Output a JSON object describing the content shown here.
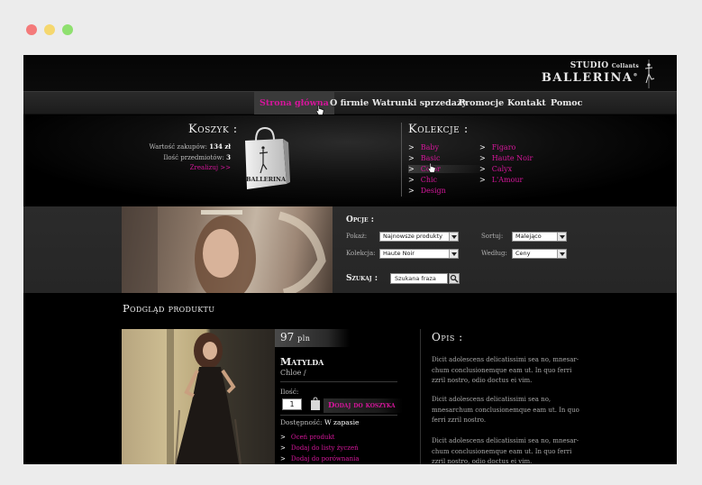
{
  "colors": {
    "accent": "#d4169a",
    "window_close": "#f47a7a",
    "window_min": "#f5d76e",
    "window_max": "#8fe06f"
  },
  "logo": {
    "line1": "STUDIO",
    "line1_small": "Collants",
    "line2": "BALLERINA",
    "mark": "®"
  },
  "nav": {
    "items": [
      "Strona główna",
      "O firmie",
      "Watrunki sprzedaży",
      "Promocje",
      "Kontakt",
      "Pomoc"
    ],
    "active_index": 0
  },
  "cart": {
    "title": "Koszyk :",
    "total_label": "Wartość zakupów:",
    "total_value": "134 zł",
    "count_label": "Ilość przedmiotów:",
    "count_value": "3",
    "checkout_link": "Zrealizuj >>",
    "bag_text": "BALLERINA"
  },
  "collections": {
    "title": "Kolekcje :",
    "left": [
      "Baby",
      "Basic",
      "Color",
      "Chic",
      "Design"
    ],
    "right": [
      "Figaro",
      "Haute Noir",
      "Calyx",
      "L'Amour"
    ],
    "highlighted": "Color",
    "bullet": ">"
  },
  "options": {
    "title": "Opcje :",
    "show_label": "Pokaż:",
    "show_value": "Najnowsze produkty",
    "sort_label": "Sortuj:",
    "sort_value": "Malejąco",
    "collection_label": "Kolekcja:",
    "collection_value": "Haute Noir",
    "by_label": "Według:",
    "by_value": "Ceny",
    "search_label": "Szukaj :",
    "search_placeholder": "Szukana fraza"
  },
  "product": {
    "section_title": "Podgląd produktu",
    "price": "97",
    "currency": "pln",
    "name": "Matylda",
    "collection": "Chloe /",
    "qty_label": "Ilość:",
    "qty_value": "1",
    "add_to_cart": "Dodaj do koszyka",
    "availability_label": "Dostępność:",
    "availability_value": "W zapasie",
    "links": [
      "Oceń produkt",
      "Dodaj do listy życzeń",
      "Dodaj do porównania"
    ]
  },
  "description": {
    "title": "Opis :",
    "paragraphs": [
      "Dicit adolescens delicatissimi sea no, mnesar-chum conclusionemque eam ut. In quo ferri zzril nostro, odio doctus ei vim.",
      "Dicit adolescens delicatissimi sea no, mnesarchum conclusionemque eam ut. In quo ferri zzril nostro.",
      "Dicit adolescens delicatissimi sea no, mnesar-chum conclusionemque eam ut. In quo ferri zzril nostro, odio doctus ei vim."
    ]
  }
}
